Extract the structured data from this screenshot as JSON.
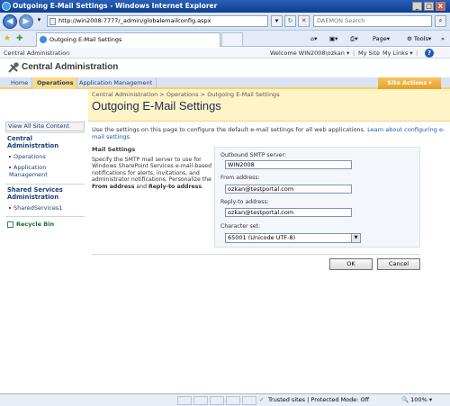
{
  "window": {
    "title": "Outgoing E-Mail Settings - Windows Internet Explorer",
    "minimize": "_",
    "maximize": "□",
    "close": "X"
  },
  "browser": {
    "url": "http://win2008:7777/_admin/globalemailconfig.aspx",
    "search_placeholder": "DAEMON Search",
    "tab_title": "Outgoing E-Mail Settings",
    "page_menu": "Page",
    "tools_menu": "Tools",
    "overflow": "»",
    "zoom": "100%",
    "status_zone": "Trusted sites | Protected Mode: Off"
  },
  "sharepoint": {
    "site_name_top": "Central Administration",
    "welcome": "Welcome WIN2008\\ozkan",
    "welcome_arrow": "▾",
    "my_site": "My Site",
    "my_links": "My Links",
    "app_title": "Central Administration",
    "nav": [
      "Home",
      "Operations",
      "Application Management"
    ],
    "site_actions": "Site Actions",
    "left_nav": {
      "view_all": "View All Site Content",
      "central_head": "Central Administration",
      "central_items": [
        "Operations",
        "Application Management"
      ],
      "ssp_head": "Shared Services Administration",
      "ssp_items": [
        "SharedServices1"
      ],
      "recycle_bin": "Recycle Bin"
    },
    "breadcrumb": "Central Administration > Operations > Outgoing E-Mail Settings",
    "page_title": "Outgoing E-Mail Settings",
    "description": "Use the settings on this page to configure the default e-mail settings for all web applications.",
    "learn_more": "Learn about configuring e-mail settings.",
    "section": {
      "heading": "Mail Settings",
      "help_1": "Specify the SMTP mail server to use for Windows SharePoint Services e-mail-based notifications for alerts, invitations, and administrator notifications. Personalize the ",
      "help_from": "From address",
      "help_and": " and ",
      "help_reply": "Reply-to address",
      "help_end": "."
    },
    "fields": {
      "smtp_label": "Outbound SMTP server:",
      "smtp_value": "WIN2008",
      "from_label": "From address:",
      "from_value": "ozkan@testportal.com",
      "reply_label": "Reply-to address:",
      "reply_value": "ozkan@testportal.com",
      "charset_label": "Character set:",
      "charset_value": "65001 (Unicode UTF-8)"
    },
    "ok": "OK",
    "cancel": "Cancel"
  }
}
